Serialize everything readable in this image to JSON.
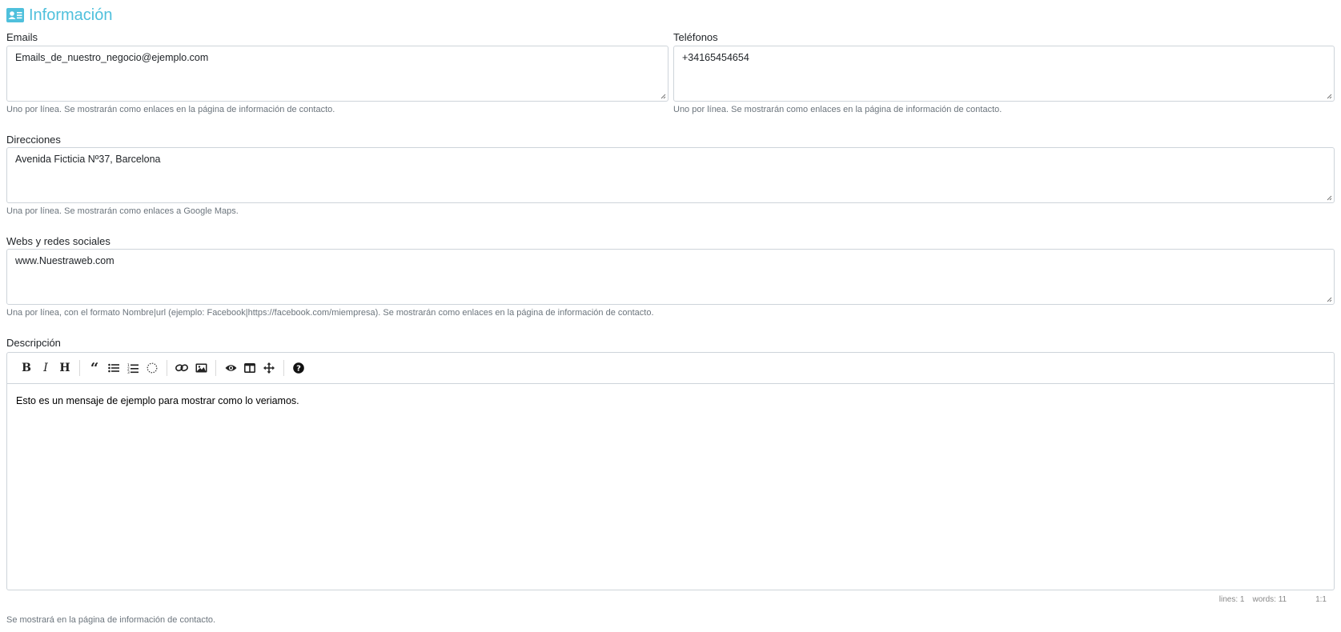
{
  "section": {
    "title": "Información",
    "icon": "contact-card-icon",
    "color": "#4fc0dc"
  },
  "emails": {
    "label": "Emails",
    "value": "Emails_de_nuestro_negocio@ejemplo.com",
    "help": "Uno por línea. Se mostrarán como enlaces en la página de información de contacto."
  },
  "phones": {
    "label": "Teléfonos",
    "value": "+34165454654",
    "help": "Uno por línea. Se mostrarán como enlaces en la página de información de contacto."
  },
  "addresses": {
    "label": "Direcciones",
    "value": "Avenida Ficticia Nº37, Barcelona",
    "help": "Una por línea. Se mostrarán como enlaces a Google Maps."
  },
  "webs": {
    "label": "Webs y redes sociales",
    "value": "www.Nuestraweb.com",
    "help": "Una por línea, con el formato Nombre|url (ejemplo: Facebook|https://facebook.com/miempresa). Se mostrarán como enlaces en la página de información de contacto."
  },
  "description": {
    "label": "Descripción",
    "content": "Esto es un mensaje de ejemplo para mostrar como lo veriamos.",
    "help": "Se mostrará en la página de información de contacto.",
    "toolbar_icons": [
      "bold-icon",
      "italic-icon",
      "heading-icon",
      "quote-icon",
      "unordered-list-icon",
      "ordered-list-icon",
      "clean-block-icon",
      "link-icon",
      "image-icon",
      "preview-icon",
      "side-by-side-icon",
      "fullscreen-icon",
      "guide-icon"
    ],
    "status": {
      "lines": "lines: 1",
      "words": "words: 11",
      "cursor": "1:1"
    }
  }
}
